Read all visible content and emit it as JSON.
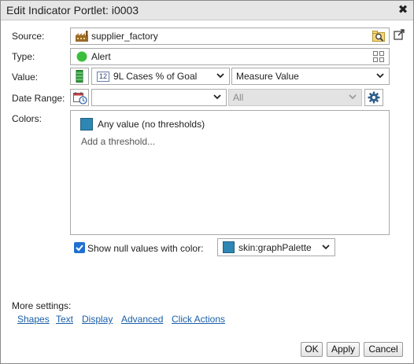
{
  "dialog": {
    "title": "Edit Indicator Portlet: i0003",
    "close_glyph": "✖"
  },
  "source": {
    "label": "Source:",
    "value": "supplier_factory",
    "icon": "factory-icon",
    "browse_icon": "magnifier-folder-icon",
    "open_icon": "external-link-icon"
  },
  "type": {
    "label": "Type:",
    "value": "Alert",
    "indicator_color": "#3cbe3c",
    "grid_icon": "grid-icon"
  },
  "value": {
    "label": "Value:",
    "column_badge": "12",
    "column": "9L Cases % of Goal",
    "measure": "Measure Value"
  },
  "date_range": {
    "label": "Date Range:",
    "value": "",
    "period": "All"
  },
  "colors": {
    "label": "Colors:",
    "swatch_color": "#2e86b3",
    "any_value": "Any value (no thresholds)",
    "add_threshold": "Add a threshold..."
  },
  "null_values": {
    "checked": true,
    "label": "Show null values with color:",
    "swatch_color": "#2e86b3",
    "value": "skin:graphPalette"
  },
  "more_settings": {
    "label": "More settings:",
    "links": [
      "Shapes",
      "Text",
      "Display",
      "Advanced",
      "Click Actions"
    ]
  },
  "buttons": {
    "ok": "OK",
    "apply": "Apply",
    "cancel": "Cancel"
  },
  "colors_theme": {
    "link": "#1a5fa8",
    "checkbox": "#1f6fd0"
  }
}
